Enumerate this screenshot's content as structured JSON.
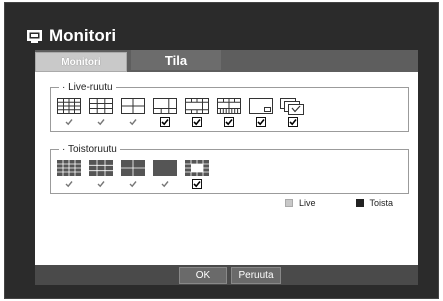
{
  "window": {
    "title": "Monitori",
    "title_icon": "monitor-icon"
  },
  "tabs": [
    {
      "label": "Monitori",
      "active": true
    },
    {
      "label": "Tila",
      "active": false
    }
  ],
  "live_group": {
    "label": "Live-ruutu",
    "layouts": [
      {
        "icon": "grid-16-icon",
        "checked": false
      },
      {
        "icon": "grid-9-icon",
        "checked": false
      },
      {
        "icon": "grid-4-icon",
        "checked": false
      },
      {
        "icon": "grid-6-icon",
        "checked": true
      },
      {
        "icon": "grid-8-icon",
        "checked": true
      },
      {
        "icon": "grid-13-icon",
        "checked": true
      },
      {
        "icon": "pip-icon",
        "checked": true
      },
      {
        "icon": "sequence-icon",
        "checked": true
      }
    ]
  },
  "playback_group": {
    "label": "Toistoruutu",
    "layouts": [
      {
        "icon": "grid-16-filled-icon",
        "checked": false
      },
      {
        "icon": "grid-9-filled-icon",
        "checked": false
      },
      {
        "icon": "grid-4-filled-icon",
        "checked": false
      },
      {
        "icon": "single-filled-icon",
        "checked": false
      },
      {
        "icon": "grid-6-filled-icon",
        "checked": true
      }
    ]
  },
  "legend": {
    "live_label": "Live",
    "live_color": "#c8c8c8",
    "playback_label": "Toista",
    "playback_color": "#222222"
  },
  "buttons": {
    "ok": "OK",
    "cancel": "Peruuta"
  },
  "colors": {
    "frame": "#2b2b2b",
    "tabbar": "#5e5e5e",
    "filled_icon": "#555555"
  }
}
